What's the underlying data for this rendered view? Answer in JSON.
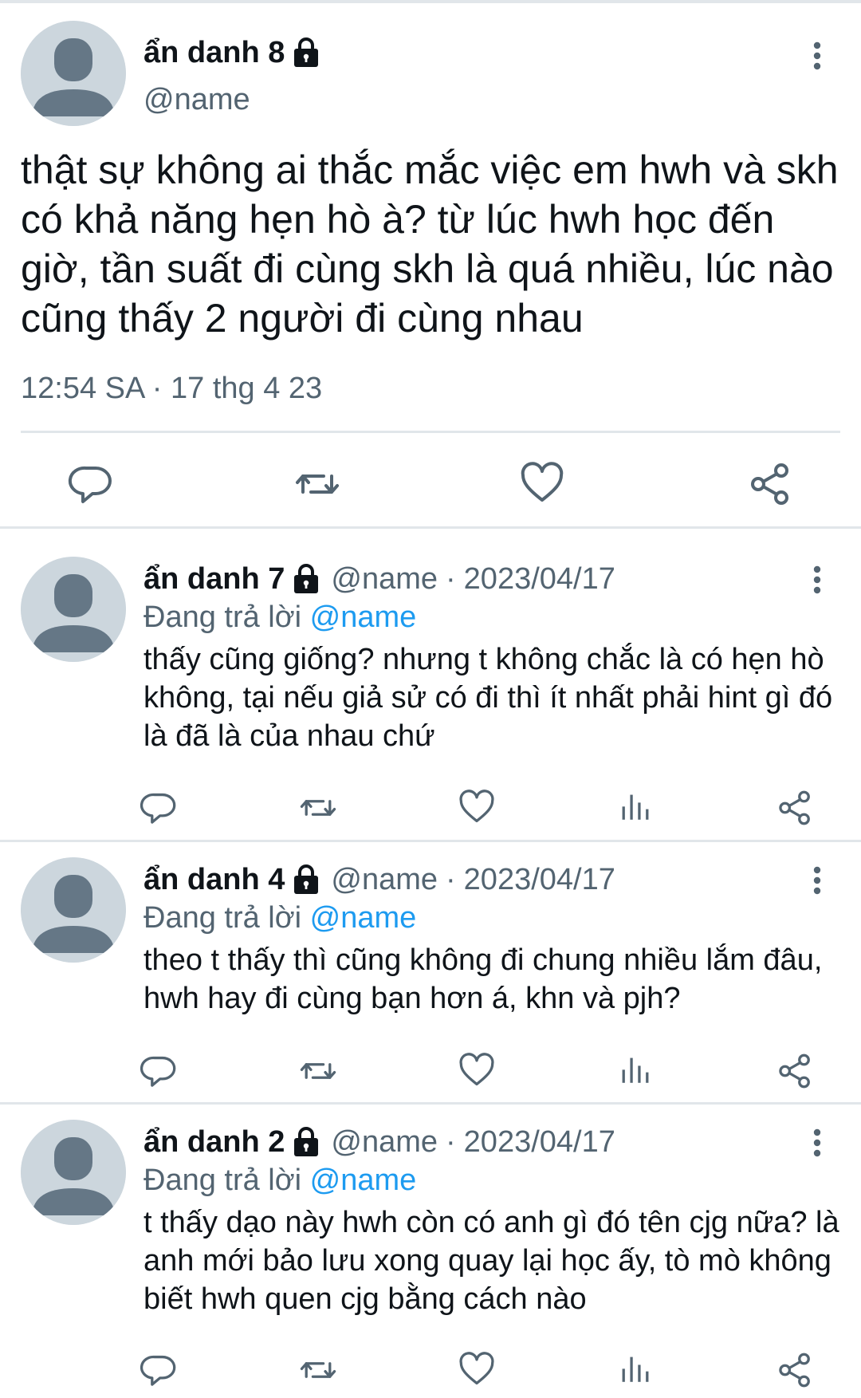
{
  "main_tweet": {
    "display_name": "ẩn danh 8",
    "handle": "@name",
    "text": "thật sự không ai thắc mắc việc em hwh và skh có khả năng hẹn hò à? từ lúc hwh học đến giờ, tần suất đi cùng skh là quá nhiều, lúc nào cũng thấy 2 người đi cùng nhau",
    "timestamp": "12:54 SA · 17 thg 4 23",
    "actions": [
      "reply-icon",
      "retweet-icon",
      "like-icon",
      "share-icon"
    ]
  },
  "replies": [
    {
      "display_name": "ẩn danh 7",
      "handle": "@name",
      "separator": "·",
      "date": "2023/04/17",
      "replying_to_prefix": "Đang trả lời",
      "replying_to_handle": "@name",
      "text": "thấy cũng giống? nhưng t không chắc là có hẹn hò không, tại nếu giả sử có đi thì ít nhất phải hint gì đó là đã là của nhau chứ"
    },
    {
      "display_name": "ẩn danh 4",
      "handle": "@name",
      "separator": "·",
      "date": "2023/04/17",
      "replying_to_prefix": "Đang trả lời",
      "replying_to_handle": "@name",
      "text": "theo t thấy thì cũng không đi chung nhiều lắm đâu, hwh hay đi cùng bạn hơn á, khn và pjh?"
    },
    {
      "display_name": "ẩn danh 2",
      "handle": "@name",
      "separator": "·",
      "date": "2023/04/17",
      "replying_to_prefix": "Đang trả lời",
      "replying_to_handle": "@name",
      "text": "t thấy dạo này hwh còn có anh gì đó tên cjg nữa? là anh mới bảo lưu xong quay lại học ấy, tò mò không biết hwh quen cjg bằng cách nào"
    }
  ],
  "reply_actions": [
    "reply-icon",
    "retweet-icon",
    "like-icon",
    "analytics-icon",
    "share-icon"
  ],
  "colors": {
    "text_primary": "#0f1419",
    "text_secondary": "#536471",
    "mention": "#1d9bf0",
    "avatar_bg": "#ccd6dd",
    "avatar_fg": "#657786",
    "divider": "#e1e6ea"
  }
}
